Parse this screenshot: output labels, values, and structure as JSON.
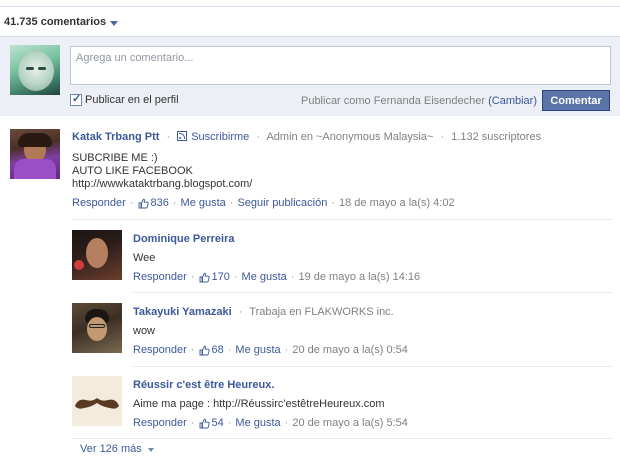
{
  "header": {
    "comment_count_label": "41.735 comentarios"
  },
  "compose": {
    "placeholder": "Agrega un comentario...",
    "publish_on_profile": "Publicar en el perfil",
    "publish_as_prefix": "Publicar como Fernanda Eisendecher",
    "change_link": "(Cambiar)",
    "submit_label": "Comentar"
  },
  "main_post": {
    "author": "Katak Trbang Ptt",
    "subscribe": "Suscribirme",
    "role": "Admin en ~Anonymous Malaysia~",
    "subscribers": "1.132 suscriptores",
    "lines": [
      "SUBCRIBE ME :)",
      "AUTO LIKE FACEBOOK",
      "http://wwwkataktrbang.blogspot.com/"
    ],
    "reply": "Responder",
    "likes": "836",
    "like": "Me gusta",
    "follow": "Seguir publicación",
    "timestamp": "18 de mayo a la(s) 4:02"
  },
  "replies": [
    {
      "author": "Dominique Perreira",
      "meta": "",
      "text": "Wee",
      "reply": "Responder",
      "likes": "170",
      "like": "Me gusta",
      "timestamp": "19 de mayo a la(s) 14:16"
    },
    {
      "author": "Takayuki Yamazaki",
      "meta": "Trabaja en FLAKWORKS inc.",
      "text": "wow",
      "reply": "Responder",
      "likes": "68",
      "like": "Me gusta",
      "timestamp": "20 de mayo a la(s) 0:54"
    },
    {
      "author": "Réussir c'est être Heureux.",
      "meta": "",
      "text": "Aime ma page : http://Réussirc'estêtreHeureux.com",
      "reply": "Responder",
      "likes": "54",
      "like": "Me gusta",
      "timestamp": "20 de mayo a la(s) 5:54"
    }
  ],
  "more": {
    "label": "Ver 126 más"
  },
  "colors": {
    "link": "#3b5998",
    "button": "#5b74a8",
    "compose_bg": "#eceff5"
  },
  "icons": {
    "like": "thumbs-up-icon",
    "rss": "rss-icon",
    "dropdown": "chevron-down-icon"
  }
}
